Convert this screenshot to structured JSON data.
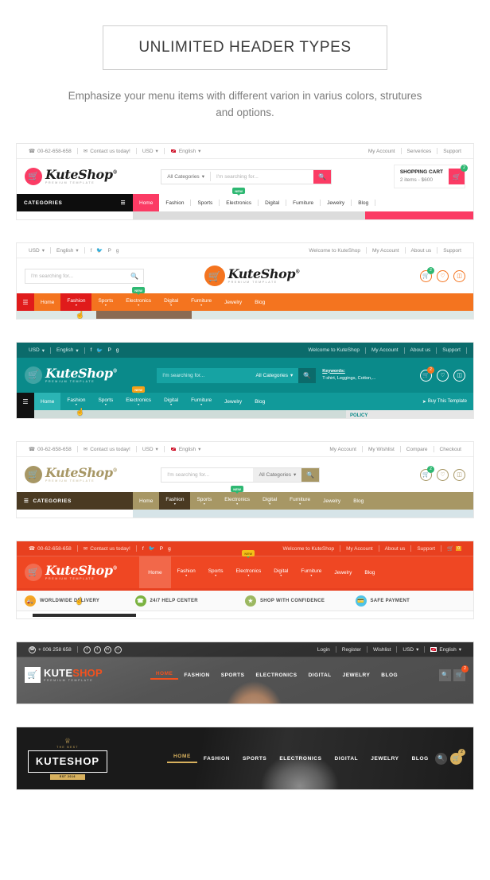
{
  "intro": {
    "title": "UNLIMITED HEADER TYPES",
    "subtitle": "Emphasize your menu items with different varion in varius colors, strutures and options."
  },
  "common": {
    "brand_name": "KuteShop",
    "brand_sup": "®",
    "brand_tagline": "PREMIUM TEMPLATE",
    "search_placeholder": "I'm searching for...",
    "all_categories": "All Categories",
    "categories_label": "CATEGORIES",
    "cart_count": "2",
    "new_badge": "NEW",
    "nav": [
      "Home",
      "Fashion",
      "Sports",
      "Electronics",
      "Digital",
      "Furniture",
      "Jewelry",
      "Blog"
    ]
  },
  "headers": [
    {
      "id": "header-pink",
      "accent": "#fb3b64",
      "topbar_left": [
        "00-62-658-658",
        "Contact us today!",
        "USD",
        "English"
      ],
      "topbar_right": [
        "My Account",
        "Serverices",
        "Support"
      ],
      "cart_title": "SHOPPING CART",
      "cart_sub": "2 items - $600",
      "active_nav": "Home"
    },
    {
      "id": "header-orange",
      "accent": "#f4741f",
      "topbar_left": [
        "USD",
        "English"
      ],
      "topbar_right": [
        "Welcome to KuteShop",
        "My Account",
        "About us",
        "Support"
      ],
      "active_nav": "Home",
      "hover_nav": "Fashion"
    },
    {
      "id": "header-teal",
      "accent": "#1aa7a7",
      "topbar_left": [
        "USD",
        "English"
      ],
      "topbar_right": [
        "Welcome to KuteShop",
        "My Account",
        "About us",
        "Support"
      ],
      "keywords_label": "Keywords:",
      "keywords_value": "T-shirt, Leggings, Cotton,...",
      "buy_template": "Buy This Template",
      "policy_label": "POLICY",
      "active_nav": "Home"
    },
    {
      "id": "header-brown",
      "accent": "#a79765",
      "topbar_left": [
        "00-62-658-658",
        "Contact us today!",
        "USD",
        "English"
      ],
      "topbar_right": [
        "My Account",
        "My Wishlist",
        "Compare",
        "Checkout"
      ],
      "active_nav": "Fashion"
    },
    {
      "id": "header-red",
      "accent": "#ef4723",
      "topbar_left": [
        "00-62-658-658",
        "Contact us today!"
      ],
      "topbar_right": [
        "Welcome to KuteShop",
        "My Account",
        "About us",
        "Support"
      ],
      "cart_count": "0",
      "active_nav": "Home",
      "services": [
        {
          "label": "WORLDWIDE DELIVERY",
          "color": "#f5a623",
          "icon": "truck-icon"
        },
        {
          "label": "24/7 HELP CENTER",
          "color": "#7cb342",
          "icon": "headset-icon"
        },
        {
          "label": "SHOP WITH CONFIDENCE",
          "color": "#9cb861",
          "icon": "shield-icon"
        },
        {
          "label": "SAFE PAYMENT",
          "color": "#4fc3e8",
          "icon": "card-icon"
        }
      ]
    },
    {
      "id": "header-photo",
      "accent": "#f4511e",
      "phone": "+ 006 258 658",
      "topbar_right": [
        "Login",
        "Register",
        "Wishlist",
        "USD",
        "English"
      ],
      "brand_first": "KUTE",
      "brand_second": "SHOP",
      "nav": [
        "HOME",
        "FASHION",
        "SPORTS",
        "ELECTRONICS",
        "DIGITAL",
        "JEWELRY",
        "BLOG"
      ],
      "active_nav": "HOME",
      "cart_count": "2"
    },
    {
      "id": "header-black",
      "accent": "#d8b15e",
      "crest_top": "THE BEST",
      "crest_name": "KUTESHOP",
      "crest_est": "EST 2016",
      "nav": [
        "HOME",
        "FASHION",
        "SPORTS",
        "ELECTRONICS",
        "DIGITAL",
        "JEWELRY",
        "BLOG"
      ],
      "active_nav": "HOME",
      "cart_count": "2"
    }
  ]
}
